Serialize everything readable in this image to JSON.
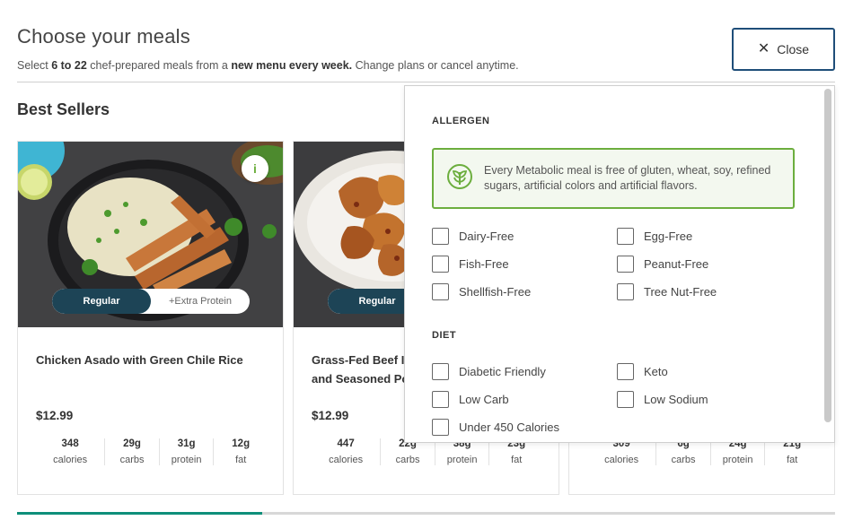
{
  "header": {
    "title": "Choose your meals",
    "subtitle_pre": "Select ",
    "subtitle_bold1": "6 to 22",
    "subtitle_mid": " chef-prepared meals from a ",
    "subtitle_bold2": "new menu every week.",
    "subtitle_post": " Change plans or cancel anytime."
  },
  "close_button": {
    "label": "Close",
    "icon": "close-icon"
  },
  "section": {
    "title": "Best Sellers"
  },
  "toggle": {
    "regular": "Regular",
    "extra": "+Extra Protein"
  },
  "cards": [
    {
      "name": "Chicken Asado with Green Chile Rice",
      "price": "$12.99",
      "info": "i",
      "nutrition": [
        {
          "value": "348",
          "label": "calories"
        },
        {
          "value": "29g",
          "label": "carbs"
        },
        {
          "value": "31g",
          "label": "protein"
        },
        {
          "value": "12g",
          "label": "fat"
        }
      ]
    },
    {
      "name": "Grass-Fed Beef Meatballs and Seasoned Potatoes",
      "name_visible_line1": "Grass-Fed Beef I",
      "name_visible_line2": "and Seasoned Po",
      "price": "$12.99",
      "nutrition": [
        {
          "value": "447",
          "label": "calories"
        },
        {
          "value": "22g",
          "label": "carbs"
        },
        {
          "value": "38g",
          "label": "protein"
        },
        {
          "value": "23g",
          "label": "fat"
        }
      ]
    },
    {
      "nutrition": [
        {
          "value": "309",
          "label": "calories"
        },
        {
          "value": "6g",
          "label": "carbs"
        },
        {
          "value": "24g",
          "label": "protein"
        },
        {
          "value": "21g",
          "label": "fat"
        }
      ]
    }
  ],
  "filter_panel": {
    "allergen_heading": "ALLERGEN",
    "notice": "Every Metabolic meal is free of gluten, wheat, soy, refined sugars, artificial colors and artificial flavors.",
    "allergens": [
      "Dairy-Free",
      "Egg-Free",
      "Fish-Free",
      "Peanut-Free",
      "Shellfish-Free",
      "Tree Nut-Free"
    ],
    "diet_heading": "DIET",
    "diets": [
      "Diabetic Friendly",
      "Keto",
      "Low Carb",
      "Low Sodium",
      "Under 450 Calories"
    ]
  },
  "progress": {
    "fraction": 0.3
  },
  "colors": {
    "accent": "#1f4e79",
    "green": "#6cae3e",
    "toggle_dark": "#1d4456",
    "progress": "#0e8f7a"
  }
}
